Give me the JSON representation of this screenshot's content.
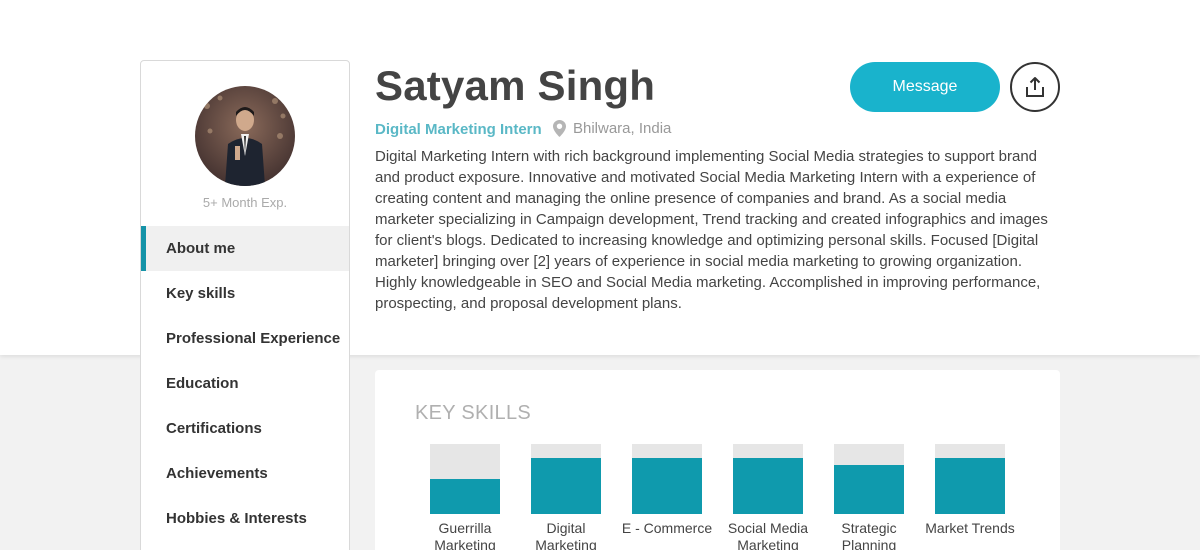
{
  "profile": {
    "name": "Satyam Singh",
    "role": "Digital Marketing Intern",
    "location": "Bhilwara, India",
    "experience": "5+ Month Exp.",
    "bio": "Digital Marketing Intern with rich background implementing Social Media strategies to support brand and product exposure. Innovative and motivated Social Media Marketing Intern with a experience of creating content and managing the online presence of companies and brand. As a social media marketer specializing in Campaign development, Trend tracking and created infographics and images for client's blogs. Dedicated to increasing knowledge and optimizing personal skills. Focused [Digital marketer] bringing over [2] years of experience in social media marketing to growing organization. Highly knowledgeable in SEO and Social Media marketing. Accomplished in improving performance, prospecting, and proposal development plans."
  },
  "actions": {
    "message_label": "Message",
    "share_icon": "share-upload-icon"
  },
  "sidebar": {
    "items": [
      {
        "label": "About me",
        "active": true
      },
      {
        "label": "Key skills",
        "active": false
      },
      {
        "label": "Professional Experience",
        "active": false
      },
      {
        "label": "Education",
        "active": false
      },
      {
        "label": "Certifications",
        "active": false
      },
      {
        "label": "Achievements",
        "active": false
      },
      {
        "label": "Hobbies & Interests",
        "active": false
      }
    ]
  },
  "skills": {
    "title": "KEY SKILLS",
    "items": [
      {
        "label": "Guerrilla Marketing",
        "level": 0.5
      },
      {
        "label": "Digital Marketing",
        "level": 0.8
      },
      {
        "label": "E - Commerce",
        "level": 0.8
      },
      {
        "label": "Social Media Marketing",
        "level": 0.8
      },
      {
        "label": "Strategic Planning",
        "level": 0.7
      },
      {
        "label": "Market Trends",
        "level": 0.8
      }
    ]
  },
  "colors": {
    "accent": "#19b3cc",
    "skill_bar": "#0f9aad",
    "role_text": "#5ab8c6"
  }
}
